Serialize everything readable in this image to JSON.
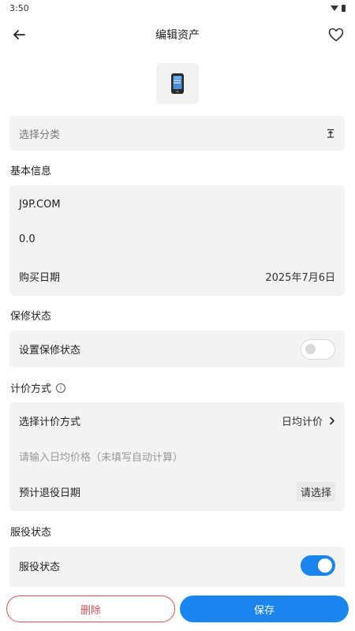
{
  "status_bar": {
    "time": "3:50"
  },
  "header": {
    "title": "编辑资产"
  },
  "category": {
    "placeholder": "选择分类"
  },
  "basic_info": {
    "section_title": "基本信息",
    "name_value": "J9P.COM",
    "price_value": "0.0",
    "purchase_date_label": "购买日期",
    "purchase_date_value": "2025年7月6日"
  },
  "warranty": {
    "section_title": "保修状态",
    "toggle_label": "设置保修状态",
    "enabled": false
  },
  "pricing": {
    "section_title": "计价方式",
    "method_label": "选择计价方式",
    "method_value": "日均计价",
    "daily_price_placeholder": "请输入日均价格（未填写自动计算）",
    "retire_date_label": "预计退役日期",
    "retire_date_value": "请选择"
  },
  "service": {
    "section_title": "服役状态",
    "toggle_label": "服役状态",
    "enabled": true
  },
  "actions": {
    "delete_label": "删除",
    "save_label": "保存"
  },
  "colors": {
    "accent": "#1a85ef",
    "danger": "#e05353",
    "card_bg": "#f3f3f3"
  }
}
